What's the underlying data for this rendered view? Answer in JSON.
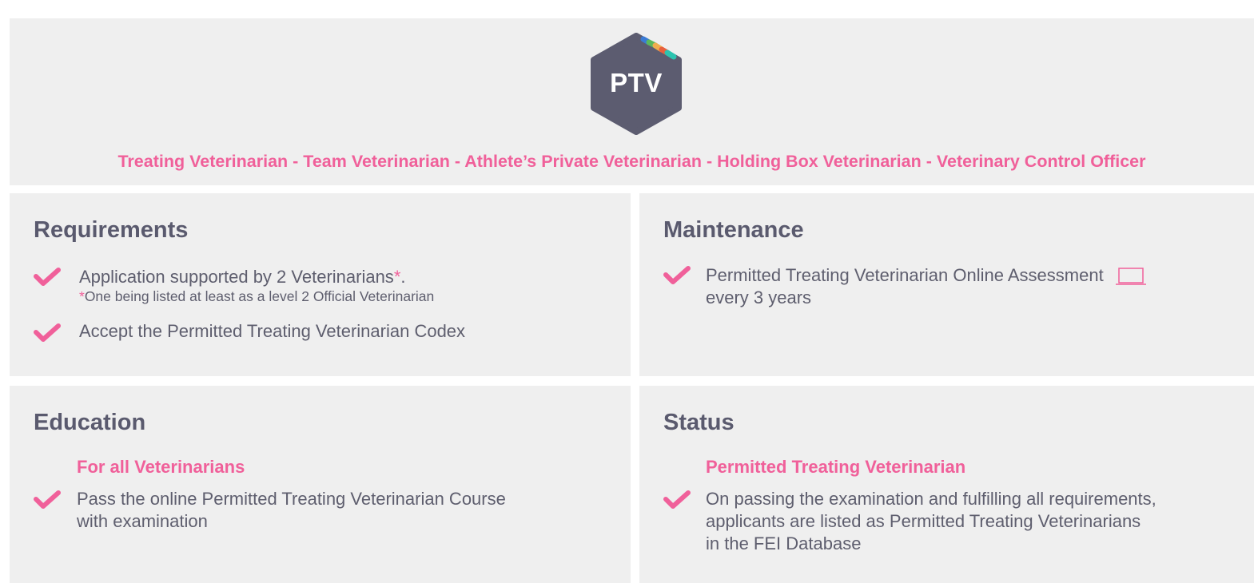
{
  "header": {
    "badge_text": "PTV",
    "roles_line": "Treating Veterinarian - Team Veterinarian - Athlete’s Private Veterinarian - Holding Box Veterinarian - Veterinary Control Officer"
  },
  "requirements": {
    "title": "Requirements",
    "item1": "Application supported by 2 Veterinarians",
    "item1_star": "*",
    "item1_end": ".",
    "item1_note_star": "*",
    "item1_note": "One being listed at least as a level 2 Official Veterinarian",
    "item2": "Accept the Permitted Treating Veterinarian Codex"
  },
  "maintenance": {
    "title": "Maintenance",
    "line1": "Permitted Treating Veterinarian Online Assessment",
    "line2": "every 3 years",
    "icon": "laptop-icon"
  },
  "education": {
    "title": "Education",
    "subheading": "For all Veterinarians",
    "line1": "Pass the online Permitted Treating Veterinarian Course",
    "line2": "with examination"
  },
  "status": {
    "title": "Status",
    "subheading": "Permitted Treating Veterinarian",
    "line1": "On passing the examination and fulfilling all requirements,",
    "line2": "applicants are listed as Permitted Treating Veterinarians",
    "line3": "in the FEI Database"
  },
  "colors": {
    "accent": "#f0609a",
    "heading": "#5a5a6e",
    "panel": "#efefef",
    "badge": "#5c5c70"
  }
}
